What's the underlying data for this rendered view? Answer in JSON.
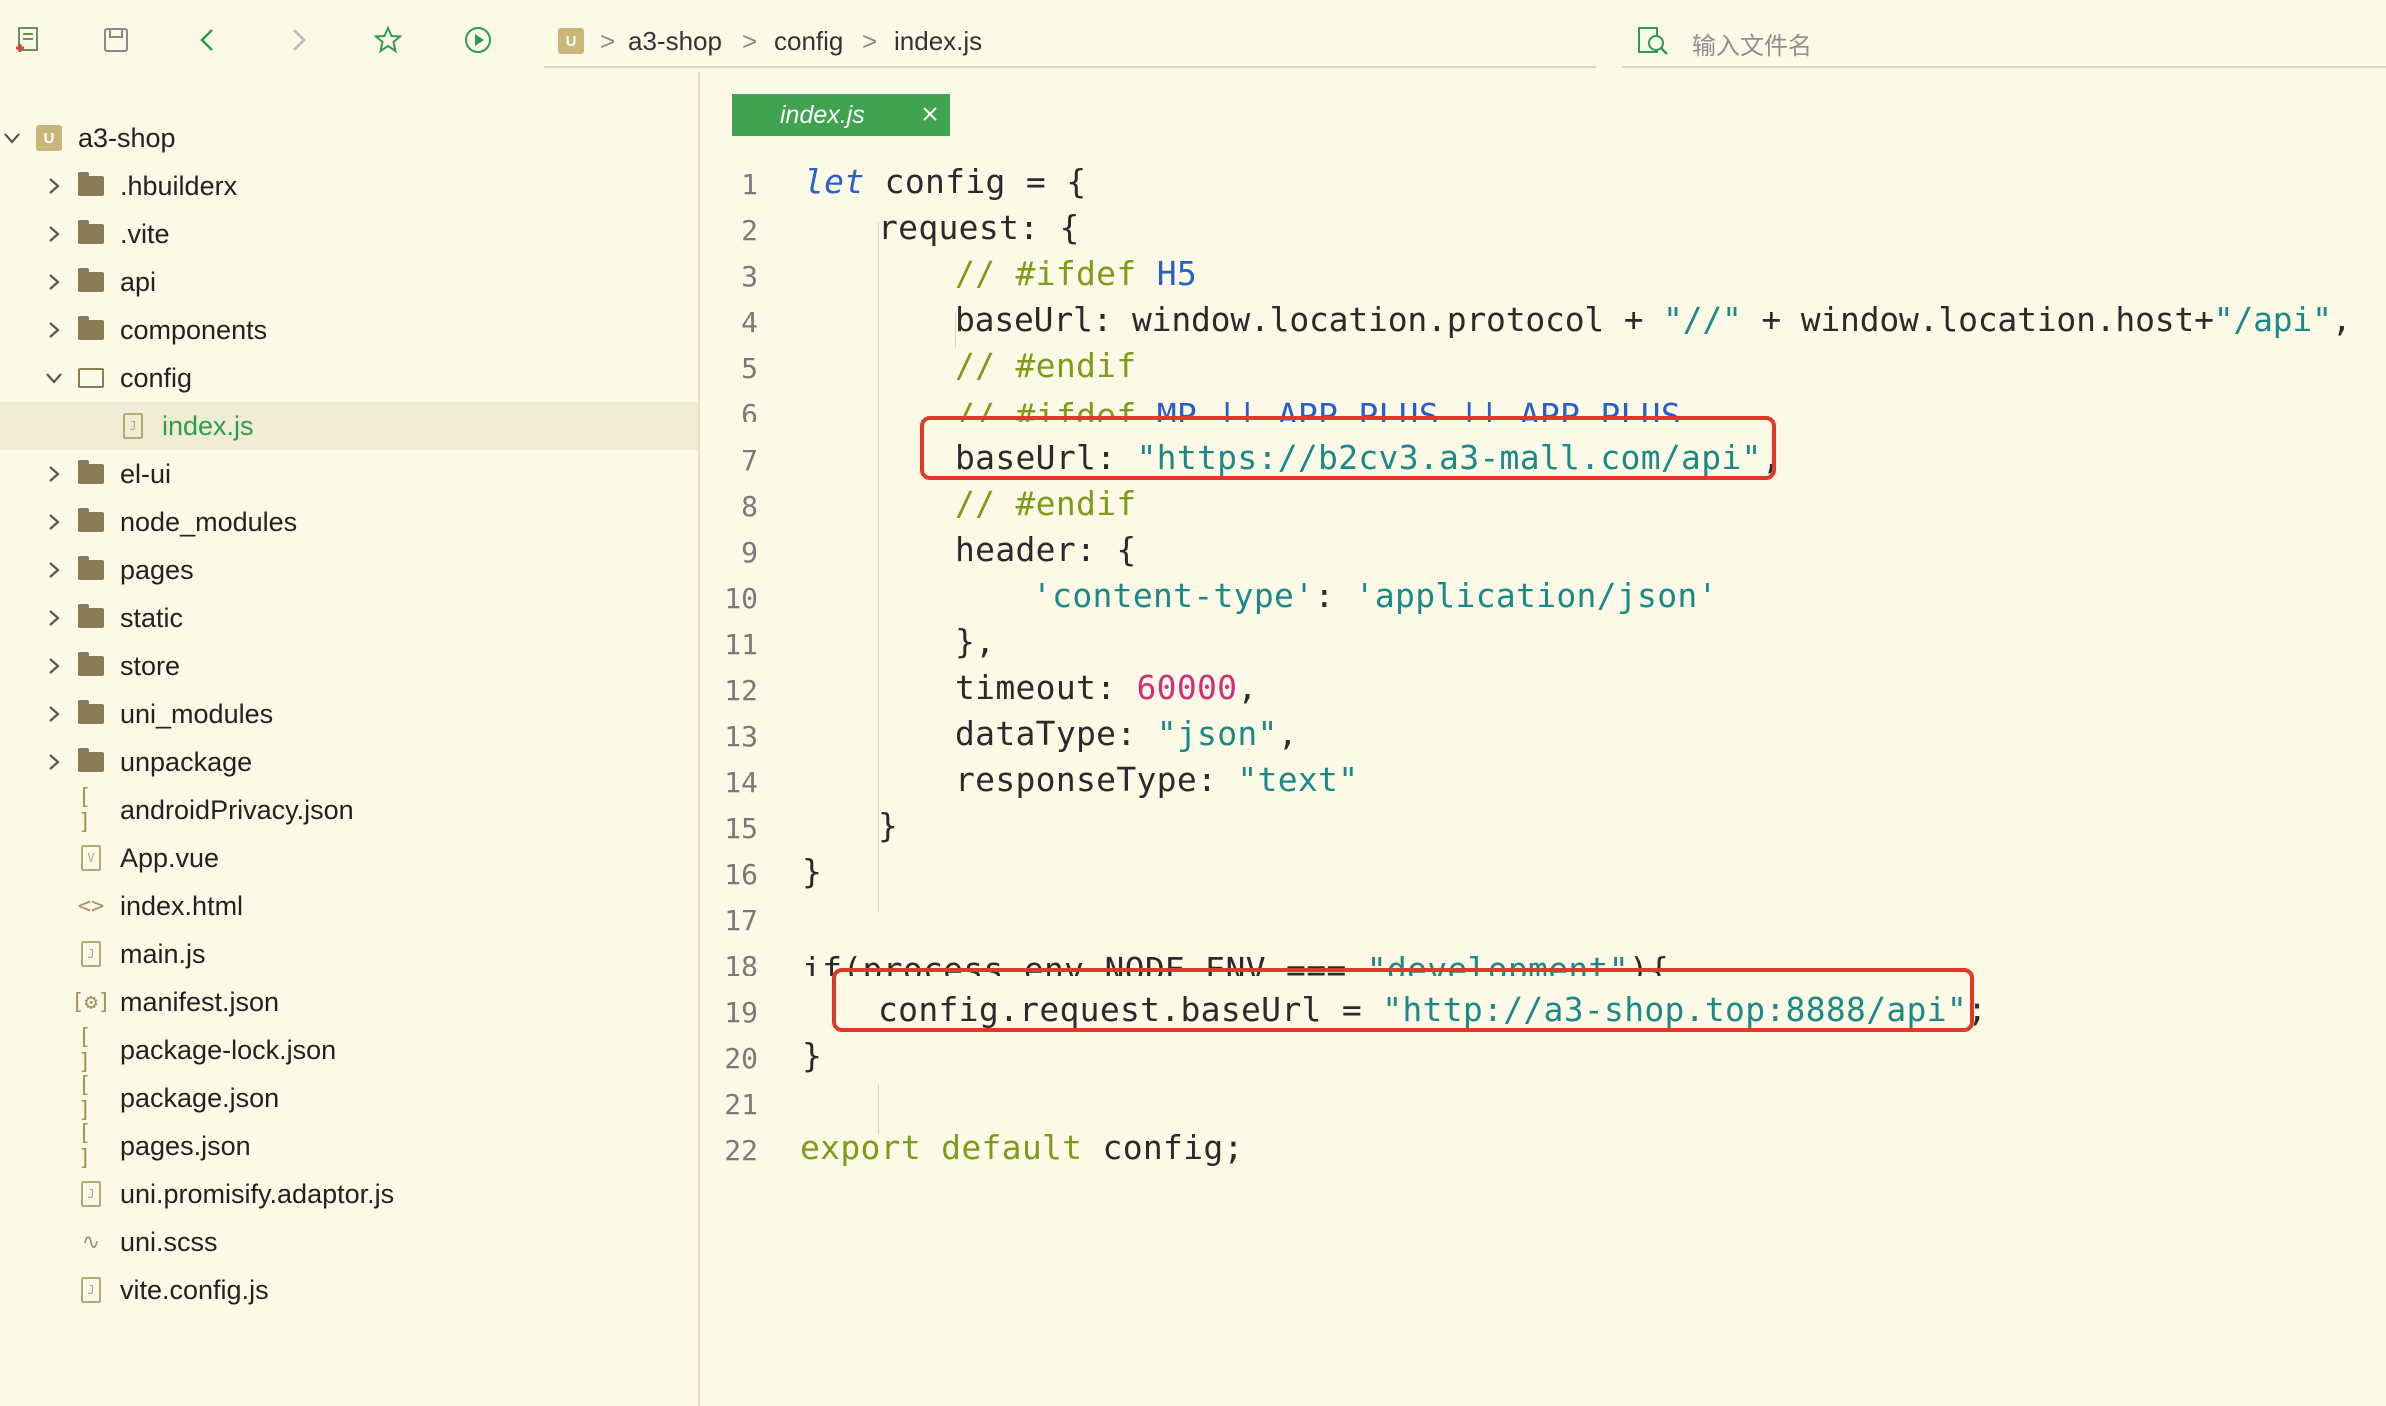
{
  "toolbar": {
    "icons": [
      "new-file-icon",
      "save-icon",
      "back-icon",
      "forward-icon",
      "star-icon",
      "run-icon"
    ]
  },
  "breadcrumb": {
    "project_badge": "U",
    "project": "a3-shop",
    "folder": "config",
    "file": "index.js",
    "separator": ">"
  },
  "search": {
    "placeholder": "输入文件名"
  },
  "sidebar": {
    "project": "a3-shop",
    "items": [
      {
        "label": ".hbuilderx",
        "type": "folder"
      },
      {
        "label": ".vite",
        "type": "folder"
      },
      {
        "label": "api",
        "type": "folder"
      },
      {
        "label": "components",
        "type": "folder"
      },
      {
        "label": "config",
        "type": "folder-open"
      },
      {
        "label": "index.js",
        "type": "file-js",
        "selected": true
      },
      {
        "label": "el-ui",
        "type": "folder"
      },
      {
        "label": "node_modules",
        "type": "folder"
      },
      {
        "label": "pages",
        "type": "folder"
      },
      {
        "label": "static",
        "type": "folder"
      },
      {
        "label": "store",
        "type": "folder"
      },
      {
        "label": "uni_modules",
        "type": "folder"
      },
      {
        "label": "unpackage",
        "type": "folder"
      },
      {
        "label": "androidPrivacy.json",
        "type": "file-json"
      },
      {
        "label": "App.vue",
        "type": "file-vue"
      },
      {
        "label": "index.html",
        "type": "file-html"
      },
      {
        "label": "main.js",
        "type": "file-js"
      },
      {
        "label": "manifest.json",
        "type": "file-manifest"
      },
      {
        "label": "package-lock.json",
        "type": "file-json"
      },
      {
        "label": "package.json",
        "type": "file-json"
      },
      {
        "label": "pages.json",
        "type": "file-json"
      },
      {
        "label": "uni.promisify.adaptor.js",
        "type": "file-js"
      },
      {
        "label": "uni.scss",
        "type": "file-scss"
      },
      {
        "label": "vite.config.js",
        "type": "file-js"
      }
    ]
  },
  "editor": {
    "tab_label": "index.js",
    "line_numbers": [
      "1",
      "2",
      "3",
      "4",
      "5",
      "6",
      "7",
      "8",
      "9",
      "10",
      "11",
      "12",
      "13",
      "14",
      "15",
      "16",
      "17",
      "18",
      "19",
      "20",
      "21",
      "22"
    ],
    "lines": {
      "l1a": "let",
      "l1b": " config = {",
      "l2": "request: {",
      "l3a": "// #ifdef ",
      "l3b": "H5",
      "l4a": "baseUrl: window.location.protocol + ",
      "l4b": "\"//\"",
      "l4c": " + window.location.host+",
      "l4d": "\"/api\"",
      "l4e": ",",
      "l5": "// #endif",
      "l6a": "// #ifdef ",
      "l6b": "MP || APP-PLUS || APP-PLUS",
      "l7a": "baseUrl: ",
      "l7b": "\"https://b2cv3.a3-mall.com/api\"",
      "l7c": ",",
      "l8": "// #endif",
      "l9": "header: {",
      "l10a": "'content-type'",
      "l10b": ": ",
      "l10c": "'application/json'",
      "l11": "},",
      "l12a": "timeout: ",
      "l12b": "60000",
      "l12c": ",",
      "l13a": "dataType: ",
      "l13b": "\"json\"",
      "l13c": ",",
      "l14a": "responseType: ",
      "l14b": "\"text\"",
      "l15": "}",
      "l16": "}",
      "l17": "",
      "l18a": "if(process.env.NODE_ENV === ",
      "l18b": "\"development\"",
      "l18c": "){",
      "l19a": "config.request.baseUrl = ",
      "l19b": "\"http://a3-shop.top:8888/api\"",
      "l19c": ";",
      "l20": "}",
      "l21": "",
      "l22a": "export default",
      "l22b": " config;"
    }
  },
  "colors": {
    "background": "#fdf9e7",
    "tab_active": "#3fa350",
    "keyword": "#2960c8",
    "comment": "#7e9b1a",
    "string": "#1b8a86",
    "number": "#d12f7b",
    "highlight_box": "#e0392a"
  }
}
